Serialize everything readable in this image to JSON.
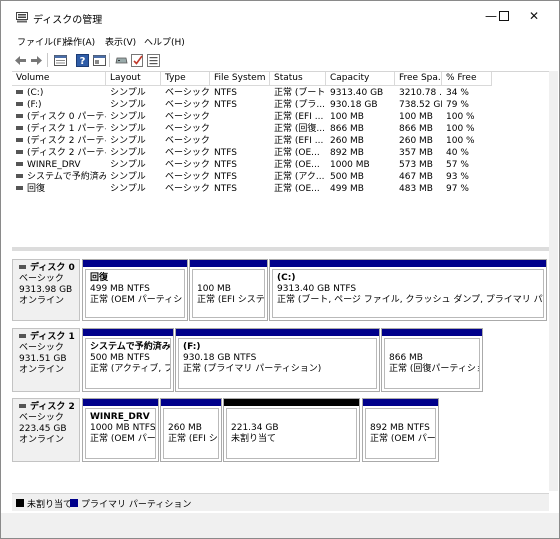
{
  "window": {
    "title": "ディスクの管理",
    "minimize": "—",
    "maximize": "☐",
    "close": "✕"
  },
  "menu": [
    "ファイル(F)",
    "操作(A)",
    "表示(V)",
    "ヘルプ(H)"
  ],
  "columns": [
    "Volume",
    "Layout",
    "Type",
    "File System",
    "Status",
    "Capacity",
    "Free Spa...",
    "% Free"
  ],
  "volumes": [
    [
      "(C:)",
      "シンプル",
      "ベーシック",
      "NTFS",
      "正常 (ブート...",
      "9313.40 GB",
      "3210.78 ...",
      "34 %"
    ],
    [
      "(F:)",
      "シンプル",
      "ベーシック",
      "NTFS",
      "正常 (プラ...",
      "930.18 GB",
      "738.52 GB",
      "79 %"
    ],
    [
      "(ディスク 0 パーティ...",
      "シンプル",
      "ベーシック",
      "",
      "正常 (EFI ...",
      "100 MB",
      "100 MB",
      "100 %"
    ],
    [
      "(ディスク 1 パーティシ...",
      "シンプル",
      "ベーシック",
      "",
      "正常 (回復...",
      "866 MB",
      "866 MB",
      "100 %"
    ],
    [
      "(ディスク 2 パーティシ...",
      "シンプル",
      "ベーシック",
      "",
      "正常 (EFI ...",
      "260 MB",
      "260 MB",
      "100 %"
    ],
    [
      "(ディスク 2 パーティシ...",
      "シンプル",
      "ベーシック",
      "NTFS",
      "正常 (OE...",
      "892 MB",
      "357 MB",
      "40 %"
    ],
    [
      "WINRE_DRV",
      "シンプル",
      "ベーシック",
      "NTFS",
      "正常 (OE...",
      "1000 MB",
      "573 MB",
      "57 %"
    ],
    [
      "システムで予約済み ...",
      "シンプル",
      "ベーシック",
      "NTFS",
      "正常 (アク...",
      "500 MB",
      "467 MB",
      "93 %"
    ],
    [
      "回復",
      "シンプル",
      "ベーシック",
      "NTFS",
      "正常 (OE...",
      "499 MB",
      "483 MB",
      "97 %"
    ]
  ],
  "disks": [
    {
      "name": "ディスク 0",
      "type": "ベーシック",
      "size": "9313.98 GB",
      "status": "オンライン",
      "partitions": [
        {
          "name": "回復",
          "size": "499 MB NTFS",
          "status": "正常 (OEM パーティション)",
          "kind": "primary"
        },
        {
          "name": "",
          "size": "100 MB",
          "status": "正常 (EFI システム パ",
          "kind": "primary"
        },
        {
          "name": "(C:)",
          "size": "9313.40 GB NTFS",
          "status": "正常 (ブート, ページ ファイル, クラッシュ ダンプ, プライマリ パーティション)",
          "kind": "primary"
        }
      ]
    },
    {
      "name": "ディスク 1",
      "type": "ベーシック",
      "size": "931.51 GB",
      "status": "オンライン",
      "partitions": [
        {
          "name": "システムで予約済み (D",
          "size": "500 MB NTFS",
          "status": "正常 (アクティブ, プライマ",
          "kind": "primary"
        },
        {
          "name": "(F:)",
          "size": "930.18 GB NTFS",
          "status": "正常 (プライマリ パーティション)",
          "kind": "primary"
        },
        {
          "name": "",
          "size": "866 MB",
          "status": "正常 (回復パーティション)",
          "kind": "primary"
        }
      ]
    },
    {
      "name": "ディスク 2",
      "type": "ベーシック",
      "size": "223.45 GB",
      "status": "オンライン",
      "partitions": [
        {
          "name": "WINRE_DRV",
          "size": "1000 MB NTFS",
          "status": "正常 (OEM パーティ",
          "kind": "primary"
        },
        {
          "name": "",
          "size": "260 MB",
          "status": "正常 (EFI シス",
          "kind": "primary"
        },
        {
          "name": "",
          "size": "221.34 GB",
          "status": "未割り当て",
          "kind": "unallocated"
        },
        {
          "name": "",
          "size": "892 MB NTFS",
          "status": "正常 (OEM パーティ",
          "kind": "primary"
        }
      ]
    }
  ],
  "legend": {
    "unallocated": "未割り当て",
    "primary": "プライマリ パーティション"
  },
  "colors": {
    "primary": "#00008b",
    "unallocated": "#000000"
  },
  "icons": [
    "back-arrow-icon",
    "forward-arrow-icon",
    "properties-icon",
    "help-icon",
    "console-icon",
    "check-icon",
    "settings-icon"
  ]
}
